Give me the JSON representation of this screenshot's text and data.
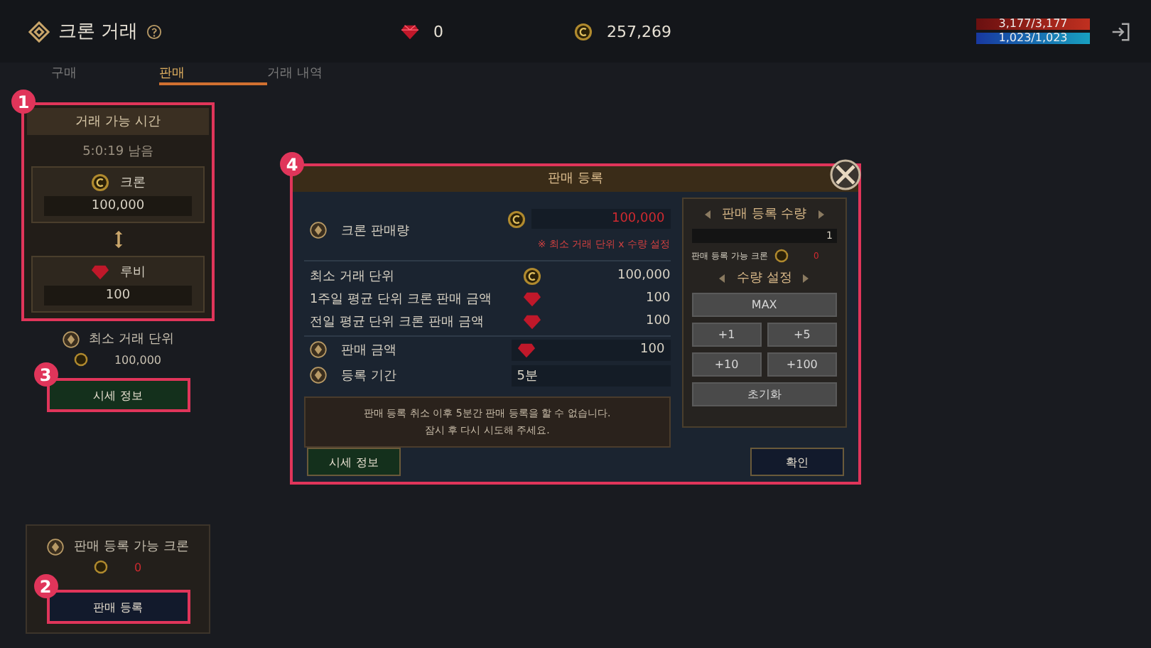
{
  "header": {
    "title": "크론 거래",
    "ruby_amount": "0",
    "crone_amount": "257,269",
    "hp": {
      "text": "3,177/3,177",
      "level": 1
    },
    "mp": {
      "text": "1,023/1,023",
      "level": 1
    }
  },
  "tabs": [
    {
      "label": "구매",
      "selected": false
    },
    {
      "label": "판매",
      "selected": true
    },
    {
      "label": "거래 내역",
      "selected": false
    }
  ],
  "trade_time_panel": {
    "callout": "1",
    "title": "거래 가능 시간",
    "remaining": "5:0:19 남음",
    "exchange": [
      {
        "kind": "crone",
        "label": "크론",
        "value": "100,000"
      },
      {
        "kind": "ruby",
        "label": "루비",
        "value": "100"
      }
    ]
  },
  "min_unit": {
    "label": "최소 거래 단위",
    "value": "100,000"
  },
  "price_info_button": {
    "callout": "3",
    "label": "시세 정보"
  },
  "sellable": {
    "label": "판매 등록 가능 크론",
    "value": "0"
  },
  "register_button": {
    "callout": "2",
    "label": "판매 등록"
  },
  "dialog": {
    "callout": "4",
    "title": "판매 등록",
    "sale_amount": {
      "label": "크론 판매량",
      "value": "100,000",
      "note": "※ 최소 거래 단위 x 수량 설정"
    },
    "info_rows": [
      {
        "label": "최소 거래 단위",
        "kind": "crone",
        "value": "100,000"
      },
      {
        "label": "1주일 평균 단위 크론 판매 금액",
        "kind": "ruby",
        "value": "100"
      },
      {
        "label": "전일 평균 단위 크론 판매 금액",
        "kind": "ruby",
        "value": "100"
      }
    ],
    "price": {
      "label": "판매 금액",
      "kind": "ruby",
      "value": "100"
    },
    "period": {
      "label": "등록 기간",
      "value": "5분"
    },
    "notice": [
      "판매 등록 취소 이후 5분간 판매 등록을 할 수 없습니다.",
      "잠시 후 다시 시도해 주세요."
    ],
    "quantity": {
      "title": "판매 등록 수량",
      "value": "1",
      "available_label": "판매 등록 가능 크론",
      "available_value": "0"
    },
    "settings": {
      "title": "수량 설정",
      "buttons": [
        {
          "label": "MAX",
          "wide": true
        },
        {
          "label": "+1",
          "wide": false
        },
        {
          "label": "+5",
          "wide": false
        },
        {
          "label": "+10",
          "wide": false
        },
        {
          "label": "+100",
          "wide": false
        },
        {
          "label": "초기화",
          "wide": true
        }
      ]
    },
    "price_info_button": "시세 정보",
    "confirm_button": "확인"
  }
}
